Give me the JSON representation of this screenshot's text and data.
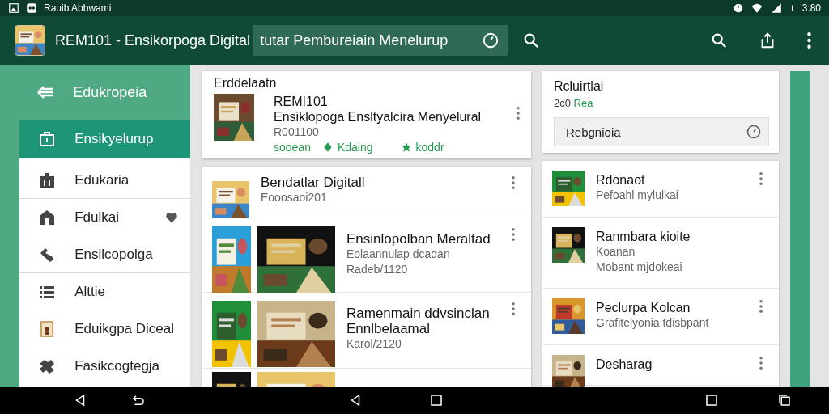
{
  "status_bar": {
    "app_label": "Rauib Abbwami",
    "time": "3:80"
  },
  "app_bar": {
    "title": "REM101 - Ensikorpoga Digital",
    "search": {
      "value": "tutar Pembureiain Menelurup"
    }
  },
  "sidebar": {
    "header": "Edukropeia",
    "items": [
      {
        "label": "Ensikyelurup",
        "selected": true
      },
      {
        "label": "Edukaria",
        "selected": false
      },
      {
        "label": "Fdulkai",
        "selected": false
      },
      {
        "label": "Ensilcopolga",
        "selected": false
      },
      {
        "label": "Alttie",
        "selected": false
      },
      {
        "label": "Eduikgpa Diceal",
        "selected": false
      },
      {
        "label": "Fasikcogtegja",
        "selected": false
      }
    ]
  },
  "featured": {
    "heading": "Erddelaatn",
    "code": "REMI101",
    "title": "Ensiklopoga Ensltyalcira Menyelural",
    "number": "R001100",
    "tags": [
      "sooean",
      "Kdaing",
      "koddr"
    ]
  },
  "books": [
    {
      "title": "Bendatlar Digitall",
      "lines": [
        "Eooosaoi201"
      ]
    },
    {
      "title": "Ensinlopolban Meraltad",
      "lines": [
        "Eolaannulap dcadan",
        "Radeb/1120"
      ]
    },
    {
      "title": "Ramenmain ddvsinclan Ennlbelaamal",
      "lines": [
        "Karol/2120"
      ]
    },
    {
      "kind": "picture"
    }
  ],
  "side_card": {
    "title": "Rcluirtlai",
    "count": "2c0",
    "count_label": "Rea",
    "field": {
      "value": "Rebgnioia"
    }
  },
  "side_list": [
    {
      "title": "Rdonaot",
      "lines": [
        "Pefoahl mylulkai"
      ]
    },
    {
      "title": "Ranmbara kioite",
      "lines": [
        "Koanan",
        "Mobant mjdokeai"
      ]
    },
    {
      "title": "Peclurpa Kolcan",
      "lines": [
        "Grafitelyonia tdisbpant"
      ]
    },
    {
      "title": "Desharag"
    }
  ]
}
